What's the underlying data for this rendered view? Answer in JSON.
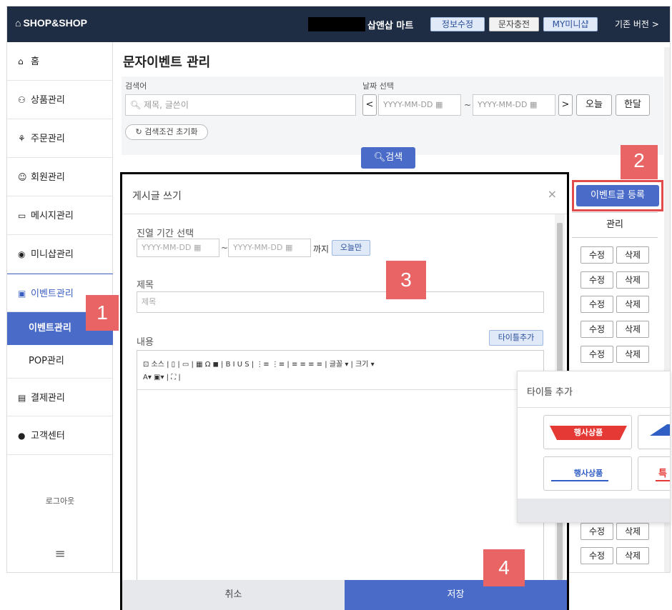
{
  "topbar": {
    "brand": "SHOP&SHOP",
    "store_name": "삽앤삽 마트",
    "buttons": [
      "정보수정",
      "문자충전",
      "MY미니샵"
    ],
    "old_version": "기존 버전 >"
  },
  "sidebar": {
    "items": [
      {
        "icon": "⌂",
        "label": "홈"
      },
      {
        "icon": "⚇",
        "label": "상품관리"
      },
      {
        "icon": "⚘",
        "label": "주문관리"
      },
      {
        "icon": "☺",
        "label": "회원관리"
      },
      {
        "icon": "▭",
        "label": "메시지관리"
      },
      {
        "icon": "◉",
        "label": "미니샵관리"
      },
      {
        "icon": "▣",
        "label": "이벤트관리"
      },
      {
        "icon": "▤",
        "label": "결제관리"
      },
      {
        "icon": "●",
        "label": "고객센터"
      }
    ],
    "submenu": [
      "이벤트관리",
      "POP관리"
    ],
    "logout": "로그아웃",
    "menu_icon": "≡"
  },
  "page": {
    "title": "문자이벤트 관리"
  },
  "search": {
    "keyword_label": "검색어",
    "keyword_placeholder": "제목, 글쓴이",
    "date_label": "날짜 선택",
    "date_from_placeholder": "YYYY-MM-DD",
    "date_to_placeholder": "YYYY-MM-DD",
    "today_btn": "오늘",
    "month_btn": "한달",
    "reset_btn": "검색조건 초기화",
    "search_btn": "검색",
    "prev": "<",
    "next": ">",
    "tilde": "~"
  },
  "list": {
    "register_btn": "이벤트글 등록",
    "manage_header": "관리",
    "edit_label": "수정",
    "delete_label": "삭제"
  },
  "modal": {
    "title": "게시글 쓰기",
    "close": "×",
    "period_label": "진열 기간 선택",
    "date_placeholder": "YYYY-MM-DD",
    "until": "까지",
    "today_only": "오늘만",
    "subject_label": "제목",
    "subject_placeholder": "제목",
    "content_label": "내용",
    "add_title_btn": "타이틀추가",
    "toolbar_row1": "⊡ 소스 | ▯ | ▭ | ▦ Ω ◼ | B  I  U  S | ⋮≡ ⋮≡ | ≡ ≡ ≡ ≡ | 글꼴        ▾ | 크기       ▾",
    "toolbar_row2": "A▾ ▣▾ | ⛶ |",
    "cancel_btn": "취소",
    "save_btn": "저장"
  },
  "title_popup": {
    "title": "타이틀 추가",
    "cards": [
      "행사상품",
      "",
      "행사상품",
      "특"
    ]
  },
  "markers": [
    "1",
    "2",
    "3",
    "4"
  ],
  "colors": {
    "topbar": "#1f2d44",
    "primary": "#4a6cc8",
    "marker": "#e96565"
  }
}
